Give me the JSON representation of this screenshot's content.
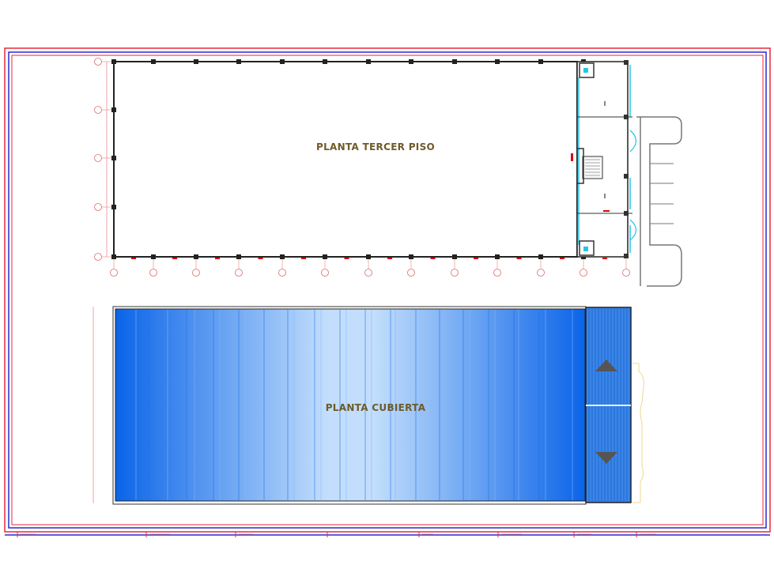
{
  "plans": {
    "third_floor_title": "PLANTA TERCER PISO",
    "roof_title": "PLANTA CUBIERTA"
  },
  "colors": {
    "outer_frame": "#e8283a",
    "inner_frame": "#2a2ad0",
    "wall": "#222222",
    "glass": "#22c6e8",
    "roof_dark": "#0a64e8",
    "roof_light": "#b8d8fc",
    "stripe_panel": "#3a86e8",
    "arrow": "#555555",
    "dimension": "#e00000",
    "grid_bubble": "#e06a6a"
  },
  "icons": {
    "slope_up": "triangle-up-icon",
    "slope_down": "triangle-down-icon"
  }
}
